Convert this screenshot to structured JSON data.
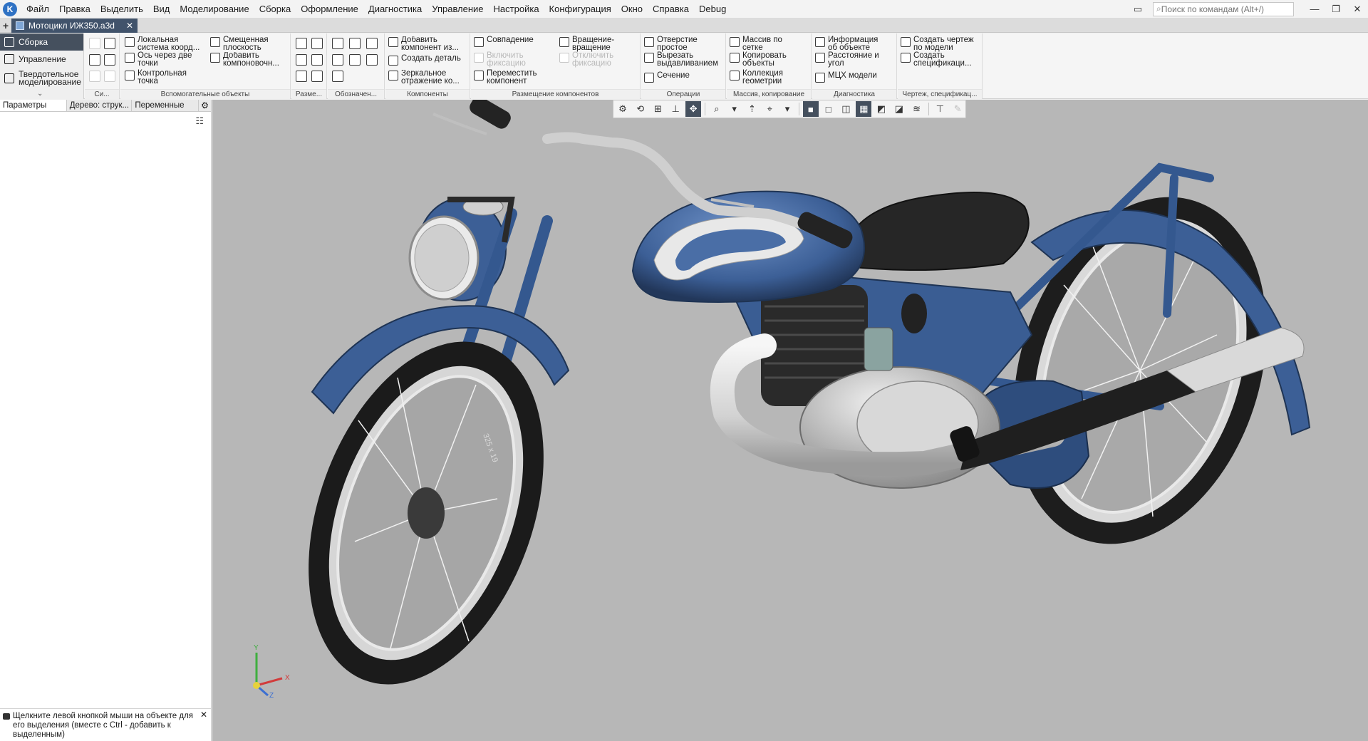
{
  "app": {
    "logo_letter": "K"
  },
  "menu": [
    "Файл",
    "Правка",
    "Выделить",
    "Вид",
    "Моделирование",
    "Сборка",
    "Оформление",
    "Диагностика",
    "Управление",
    "Настройка",
    "Конфигурация",
    "Окно",
    "Справка",
    "Debug"
  ],
  "search": {
    "placeholder": "Поиск по командам (Alt+/)"
  },
  "document_tab": {
    "title": "Мотоцикл ИЖ350.a3d"
  },
  "modes": [
    "Сборка",
    "Управление",
    "Твердотельное моделирование"
  ],
  "ribbon": {
    "groups": {
      "si": "Си...",
      "aux": "Вспомогательные объекты",
      "size": "Разме...",
      "marks": "Обозначен...",
      "components": "Компоненты",
      "placement": "Размещение компонентов",
      "operations": "Операции",
      "arrays": "Массив, копирование",
      "diagnostics": "Диагностика",
      "drawing": "Чертеж, спецификац..."
    },
    "aux": {
      "local_cs": "Локальная система коорд...",
      "axis_two_points": "Ось через две точки",
      "control_point": "Контрольная точка",
      "offset_plane": "Смещенная плоскость",
      "add_layout": "Добавить компоновочн..."
    },
    "components": {
      "add_from": "Добавить компонент из...",
      "create_part": "Создать деталь",
      "mirror": "Зеркальное отражение ко..."
    },
    "placement": {
      "coincidence": "Совпадение",
      "enable_fix": "Включить фиксацию",
      "move": "Переместить компонент",
      "rotate_rotate": "Вращение-вращение",
      "disable_fix": "Отключить фиксацию"
    },
    "operations": {
      "hole": "Отверстие простое",
      "extrude_cut": "Вырезать выдавливанием",
      "section": "Сечение"
    },
    "arrays": {
      "grid_array": "Массив по сетке",
      "copy_objects": "Копировать объекты",
      "geometry_collection": "Коллекция геометрии"
    },
    "diagnostics": {
      "object_info": "Информация об объекте",
      "distance_angle": "Расстояние и угол",
      "mass_props": "МЦХ модели"
    },
    "drawing": {
      "create_drawing": "Создать чертеж по модели",
      "create_spec": "Создать спецификаци..."
    }
  },
  "panel_tabs": [
    "Параметры",
    "Дерево: струк...",
    "Переменные"
  ],
  "hint": "Щелкните левой кнопкой мыши на объекте для его выделения (вместе с Ctrl - добавить к выделенным)",
  "axes": {
    "x": "X",
    "y": "Y",
    "z": "Z"
  },
  "tire_label": "325 x 19",
  "colors": {
    "body_blue": "#3c5f96",
    "accent_white": "#e8e8e8",
    "viewport_bg": "#b7b7b7",
    "active_dark": "#45505e"
  }
}
